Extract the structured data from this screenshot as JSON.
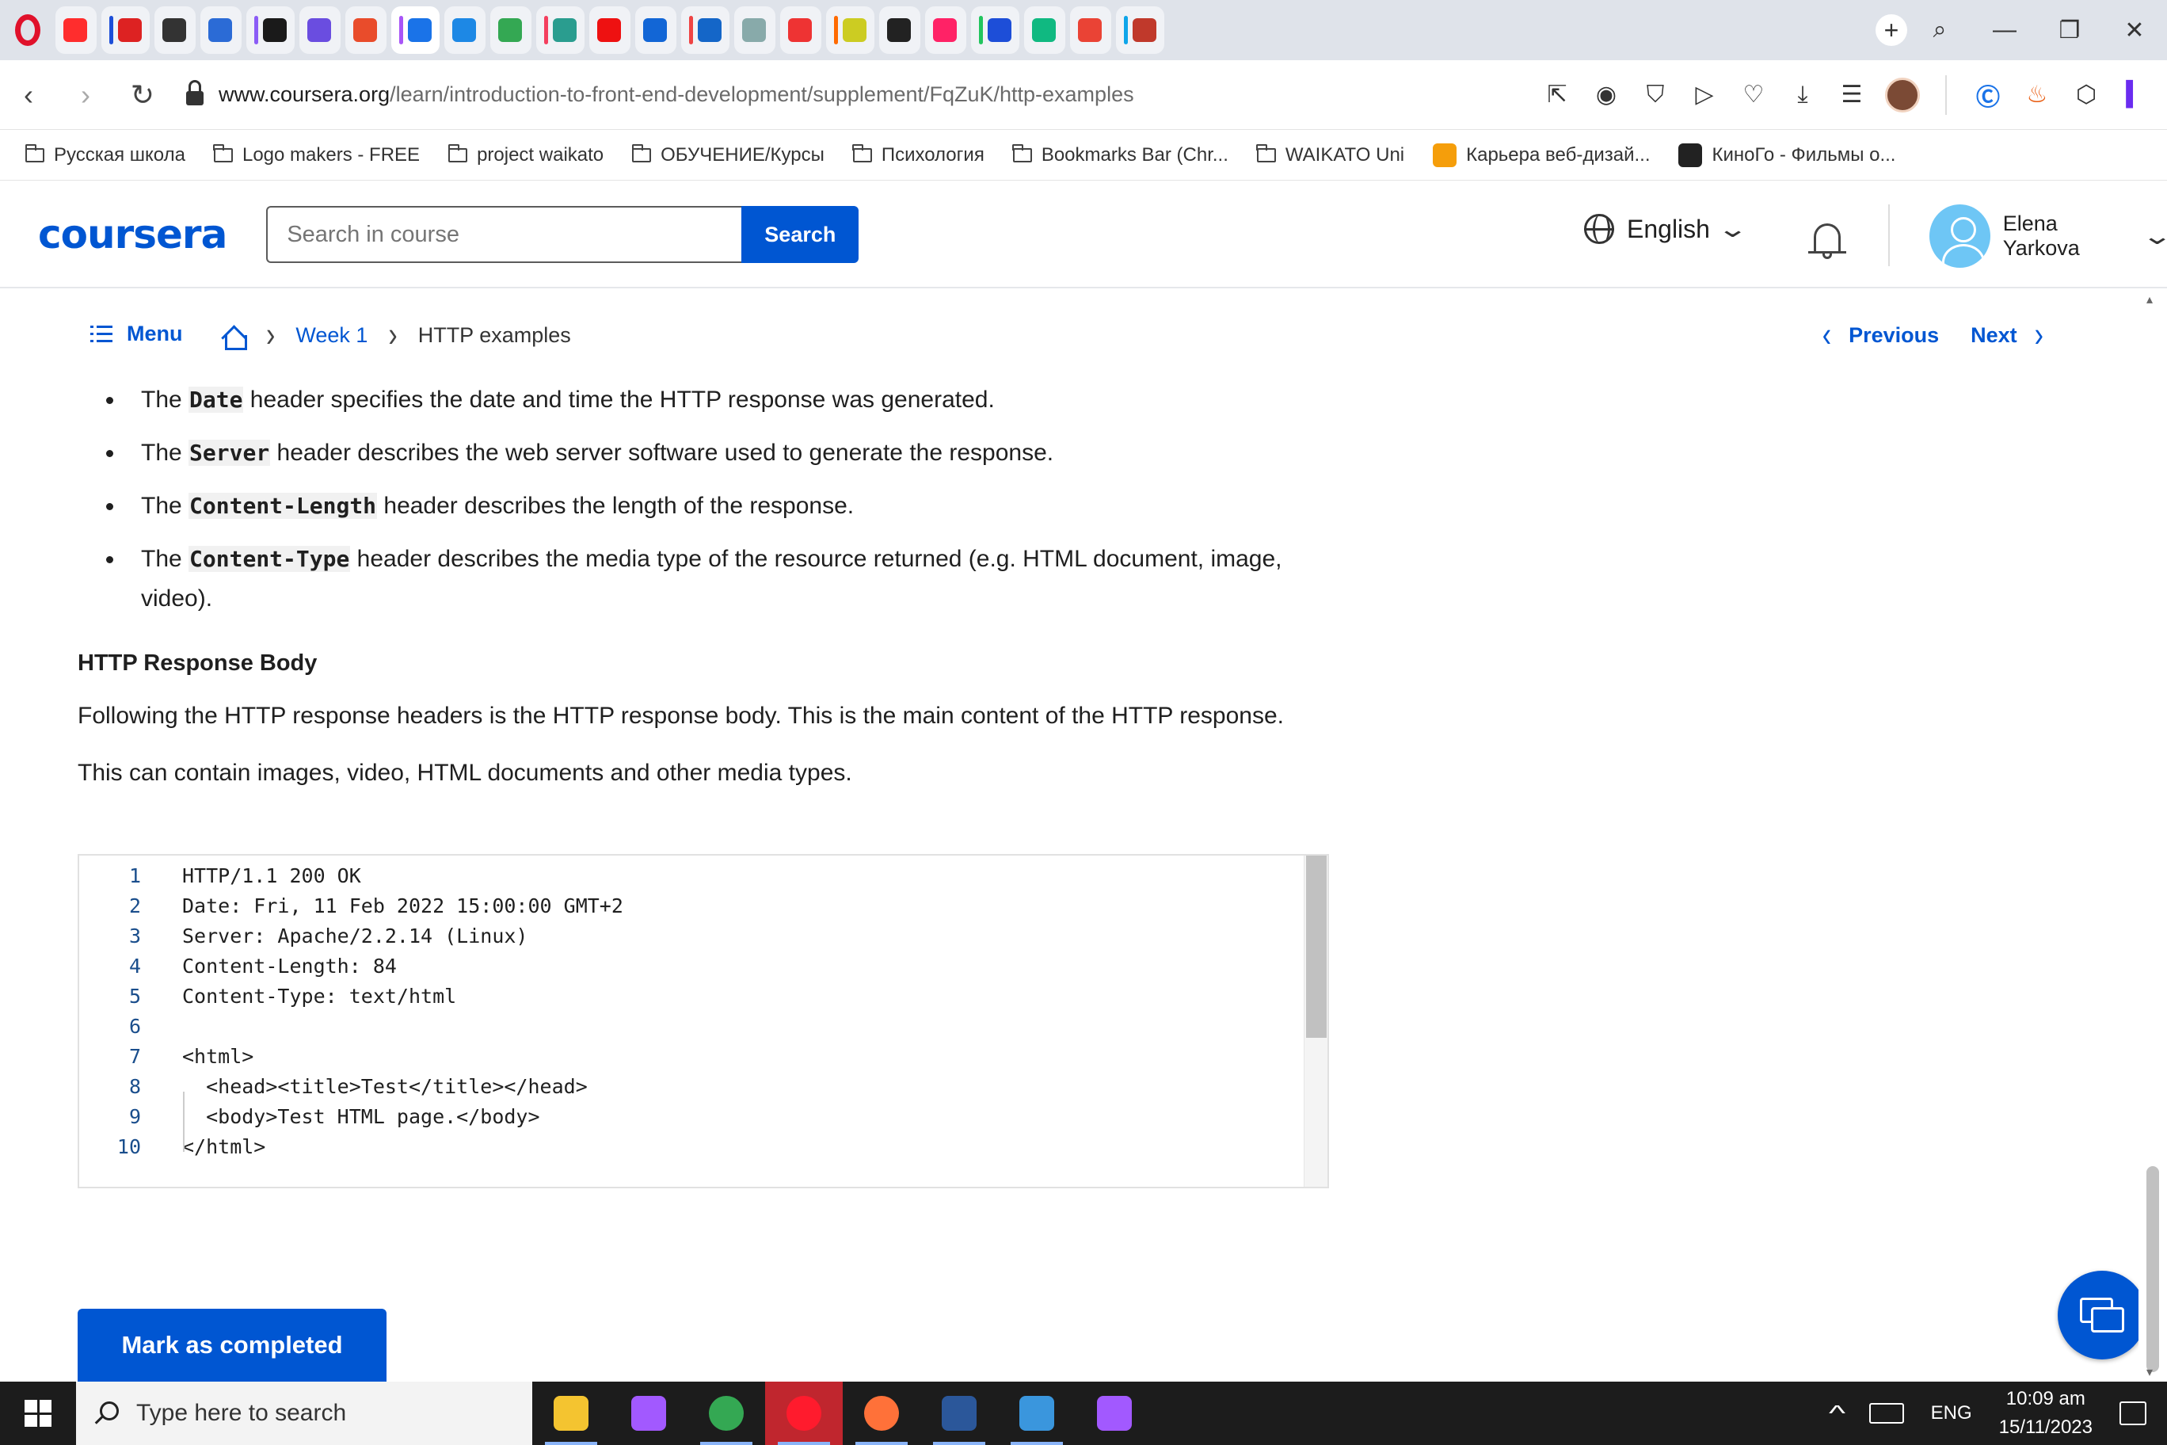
{
  "browser": {
    "tab_icon_colors": [
      "#ff2d2d",
      "#d22",
      "#333",
      "#2b6bd6",
      "#1a1a1a",
      "#6a4de0",
      "#e94c2b",
      "#1a73e8",
      "#1d88e5",
      "#34a853",
      "#2a9d8f",
      "#e11",
      "#1266d6",
      "#1466c8",
      "#8aa",
      "#e33",
      "#cc2",
      "#222",
      "#f26",
      "#1d4ed8",
      "#10b981",
      "#ea4335",
      "#c0392b"
    ],
    "url_host": "www.coursera.org",
    "url_path": "/learn/introduction-to-front-end-development/supplement/FqZuK/http-examples",
    "new_tab_symbol": "+"
  },
  "bookmarks": [
    {
      "label": "Русская школа",
      "icon": "folder-icon"
    },
    {
      "label": "Logo makers - FREE",
      "icon": "folder-icon"
    },
    {
      "label": "project waikato",
      "icon": "folder-icon"
    },
    {
      "label": "ОБУЧЕНИЕ/Курсы",
      "icon": "folder-icon"
    },
    {
      "label": "Психология",
      "icon": "folder-icon"
    },
    {
      "label": "Bookmarks Bar (Chr...",
      "icon": "folder-icon"
    },
    {
      "label": "WAIKATO Uni",
      "icon": "folder-icon"
    },
    {
      "label": "Карьера веб-дизай...",
      "icon": "site-icon"
    },
    {
      "label": "КиноГо - Фильмы о...",
      "icon": "site-icon"
    }
  ],
  "header": {
    "logo": "coursera",
    "search_placeholder": "Search in course",
    "search_button": "Search",
    "language": "English",
    "user_name": "Elena Yarkova"
  },
  "subnav": {
    "menu_label": "Menu",
    "breadcrumb_week": "Week 1",
    "breadcrumb_current": "HTTP examples",
    "previous_label": "Previous",
    "next_label": "Next"
  },
  "content": {
    "bullets": [
      {
        "pre": "The ",
        "code": "Date",
        "post": " header specifies the date and time the HTTP response was generated."
      },
      {
        "pre": "The ",
        "code": "Server",
        "post": " header describes the web server software used to generate the response."
      },
      {
        "pre": "The ",
        "code": "Content-Length",
        "post": " header describes the length of the response."
      },
      {
        "pre": "The ",
        "code": "Content-Type",
        "post": " header describes the media type of the resource returned (e.g. HTML document, image, video)."
      }
    ],
    "section_title": "HTTP Response Body",
    "paragraph_1": "Following the HTTP response headers is the HTTP response body. This is the main content of the HTTP response.",
    "paragraph_2": "This can contain images, video, HTML documents and other media types.",
    "code_lines": [
      {
        "n": "1",
        "text": "HTTP/1.1 200 OK"
      },
      {
        "n": "2",
        "text": "Date: Fri, 11 Feb 2022 15:00:00 GMT+2"
      },
      {
        "n": "3",
        "text": "Server: Apache/2.2.14 (Linux)"
      },
      {
        "n": "4",
        "text": "Content-Length: 84"
      },
      {
        "n": "5",
        "text": "Content-Type: text/html"
      },
      {
        "n": "6",
        "text": ""
      },
      {
        "n": "7",
        "text": "<html>"
      },
      {
        "n": "8",
        "text": "  <head><title>Test</title></head>"
      },
      {
        "n": "9",
        "text": "  <body>Test HTML page.</body>"
      },
      {
        "n": "10",
        "text": "</html>"
      }
    ],
    "mark_completed_label": "Mark as completed"
  },
  "taskbar": {
    "search_placeholder": "Type here to search",
    "apps": [
      {
        "name": "file-explorer-icon",
        "color": "#f4c430"
      },
      {
        "name": "figma-icon",
        "color": "#a259ff"
      },
      {
        "name": "chrome-icon",
        "color": "#34a853"
      },
      {
        "name": "opera-icon",
        "color": "#ff1b2d"
      },
      {
        "name": "firefox-icon",
        "color": "#ff7139"
      },
      {
        "name": "word-icon",
        "color": "#2b579a"
      },
      {
        "name": "photos-icon",
        "color": "#3a96dd"
      },
      {
        "name": "paint-icon",
        "color": "#a259ff"
      }
    ],
    "language": "ENG",
    "time": "10:09 am",
    "date": "15/11/2023"
  },
  "colors": {
    "brand": "#0056d2",
    "text": "#1f1f1f"
  }
}
